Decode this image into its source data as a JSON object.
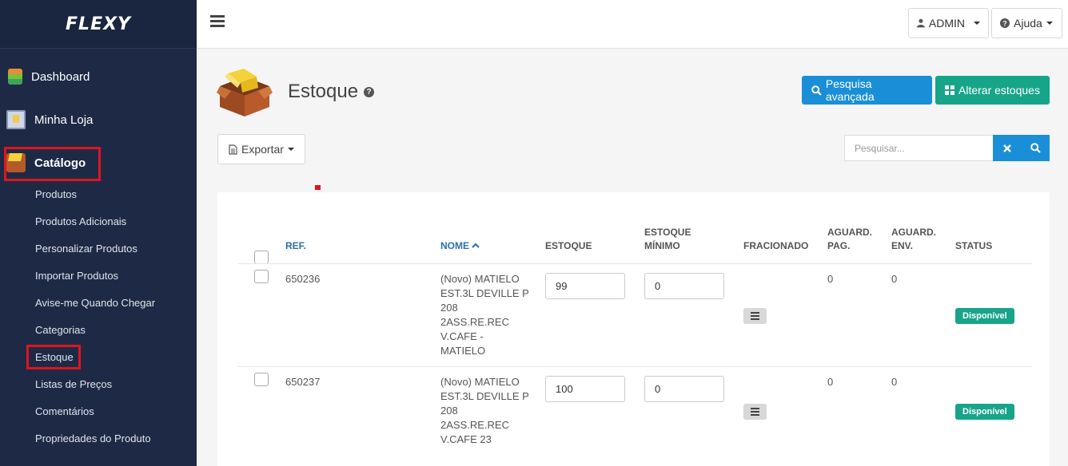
{
  "app": {
    "logo": "FLEXY"
  },
  "sidebar": {
    "main": [
      {
        "label": "Dashboard"
      },
      {
        "label": "Minha Loja"
      },
      {
        "label": "Catálogo"
      }
    ],
    "catalog_items": [
      {
        "label": "Produtos"
      },
      {
        "label": "Produtos Adicionais"
      },
      {
        "label": "Personalizar Produtos"
      },
      {
        "label": "Importar Produtos"
      },
      {
        "label": "Avise-me Quando Chegar"
      },
      {
        "label": "Categorias"
      },
      {
        "label": "Estoque"
      },
      {
        "label": "Listas de Preços"
      },
      {
        "label": "Comentários"
      },
      {
        "label": "Propriedades do Produto"
      }
    ]
  },
  "topbar": {
    "user_label": "ADMIN",
    "help_label": "Ajuda"
  },
  "page": {
    "title": "Estoque",
    "advanced_search_label": "Pesquisa avançada",
    "alter_stock_label": "Alterar estoques",
    "export_label": "Exportar",
    "search_placeholder": "Pesquisar..."
  },
  "colors": {
    "sidebar_bg": "#1e2a45",
    "primary_blue": "#1a8fd8",
    "primary_green": "#17a589",
    "highlight_red": "#e0141e"
  },
  "table": {
    "headers": {
      "ref": "REF.",
      "nome": "NOME",
      "estoque": "ESTOQUE",
      "estoque_minimo_1": "ESTOQUE",
      "estoque_minimo_2": "MÍNIMO",
      "fracionado": "FRACIONADO",
      "aguard_pag_1": "AGUARD.",
      "aguard_pag_2": "PAG.",
      "aguard_env_1": "AGUARD.",
      "aguard_env_2": "ENV.",
      "status": "STATUS"
    },
    "rows": [
      {
        "ref": "650236",
        "name_lines": [
          "(Novo) MATIELO",
          "EST.3L DEVILLE P",
          "208",
          "2ASS.RE.REC",
          "V.CAFE -",
          "MATIELO"
        ],
        "estoque": "99",
        "estoque_minimo": "0",
        "aguard_pag": "0",
        "aguard_env": "0",
        "status": "Disponível"
      },
      {
        "ref": "650237",
        "name_lines": [
          "(Novo) MATIELO",
          "EST.3L DEVILLE P",
          "208",
          "2ASS.RE.REC",
          "V.CAFE 23"
        ],
        "estoque": "100",
        "estoque_minimo": "0",
        "aguard_pag": "0",
        "aguard_env": "0",
        "status": "Disponível"
      }
    ]
  }
}
